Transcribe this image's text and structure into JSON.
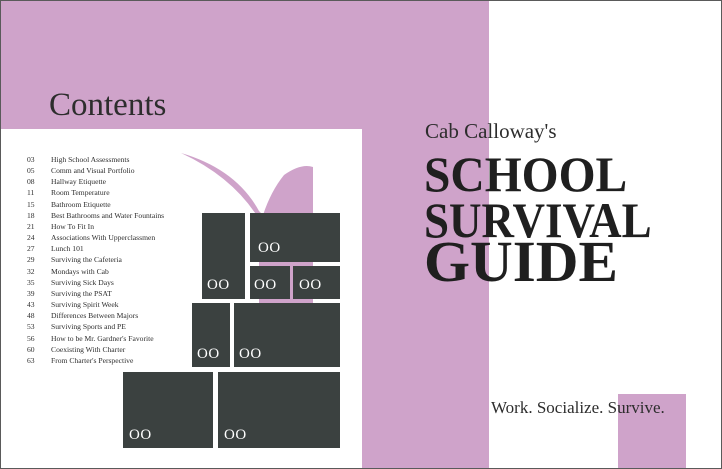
{
  "contents": {
    "title": "Contents",
    "items": [
      {
        "page": "03",
        "title": "High School Assessments"
      },
      {
        "page": "05",
        "title": "Comm and Visual Portfolio"
      },
      {
        "page": "08",
        "title": "Hallway Etiquette"
      },
      {
        "page": "11",
        "title": "Room Temperature"
      },
      {
        "page": "15",
        "title": "Bathroom Etiquette"
      },
      {
        "page": "18",
        "title": "Best Bathrooms and Water Fountains"
      },
      {
        "page": "21",
        "title": "How To Fit In"
      },
      {
        "page": "24",
        "title": "Associations With Upperclassmen"
      },
      {
        "page": "27",
        "title": "Lunch 101"
      },
      {
        "page": "29",
        "title": "Surviving the Cafeteria"
      },
      {
        "page": "32",
        "title": "Mondays with Cab"
      },
      {
        "page": "35",
        "title": "Surviving Sick Days"
      },
      {
        "page": "39",
        "title": "Surviving the PSAT"
      },
      {
        "page": "43",
        "title": "Surviving Spirit Week"
      },
      {
        "page": "48",
        "title": "Differences Between Majors"
      },
      {
        "page": "53",
        "title": "Surviving Sports and PE"
      },
      {
        "page": "56",
        "title": "How to be Mr. Gardner's Favorite"
      },
      {
        "page": "60",
        "title": "Coexisting With Charter"
      },
      {
        "page": "63",
        "title": "From Charter's Perspective"
      }
    ]
  },
  "mosaic": {
    "block_label": "OO"
  },
  "cover": {
    "brand": "Cab Calloway's",
    "title_line1": "SCHOOL",
    "title_line2": "SURVIVAL",
    "title_line3": "GUIDE",
    "tagline": "Work. Socialize. Survive."
  },
  "colors": {
    "accent": "#cfa3ca",
    "block": "#3b4140",
    "text": "#2d2d2d"
  }
}
